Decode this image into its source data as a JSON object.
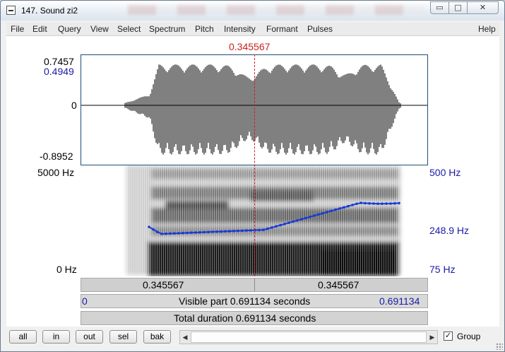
{
  "window": {
    "title": "147. Sound zi2",
    "min_icon": "minimize-icon",
    "max_icon": "maximize-icon",
    "close_icon": "close-icon"
  },
  "menu": {
    "items": [
      "File",
      "Edit",
      "Query",
      "View",
      "Select",
      "Spectrum",
      "Pitch",
      "Intensity",
      "Formant",
      "Pulses"
    ],
    "help": "Help"
  },
  "cursor": {
    "time_label": "0.345567",
    "color": "#cc1f1f"
  },
  "waveform": {
    "max_label": "0.7457",
    "cursor_amplitude": "0.4949",
    "zero_label": "0",
    "min_label": "-0.8952"
  },
  "spectrogram": {
    "freq_top": "5000 Hz",
    "freq_bottom": "0 Hz"
  },
  "pitch": {
    "top_label": "500 Hz",
    "cursor_value": "248.9 Hz",
    "bottom_label": "75 Hz",
    "color": "#1a3ad6"
  },
  "bars": {
    "cursor_left": "0.345567",
    "cursor_right": "0.345567",
    "visible_start": "0",
    "visible_text": "Visible part 0.691134 seconds",
    "visible_end": "0.691134",
    "total_text": "Total duration 0.691134 seconds"
  },
  "buttons": {
    "all": "all",
    "in": "in",
    "out": "out",
    "sel": "sel",
    "bak": "bak"
  },
  "group": {
    "label": "Group",
    "checked": "✓"
  }
}
